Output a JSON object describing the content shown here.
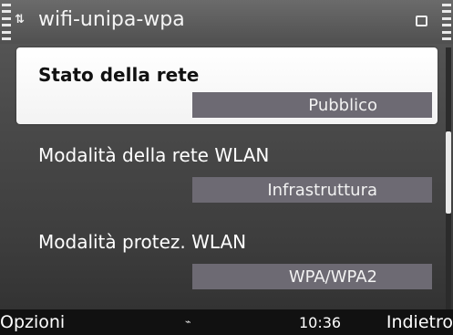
{
  "header": {
    "title": "wifi-unipa-wpa",
    "network_icon": "3.5g-icon"
  },
  "settings": [
    {
      "label": "Stato della rete",
      "value": "Pubblico"
    },
    {
      "label": "Modalità della rete WLAN",
      "value": "Infrastruttura"
    },
    {
      "label": "Modalità protez. WLAN",
      "value": "WPA/WPA2"
    }
  ],
  "softkeys": {
    "left": "Opzioni",
    "right": "Indietro",
    "clock": "10:36"
  },
  "colors": {
    "selected_bg": "#ffffff",
    "value_bg": "#6d6a73",
    "text": "#ffffff"
  }
}
